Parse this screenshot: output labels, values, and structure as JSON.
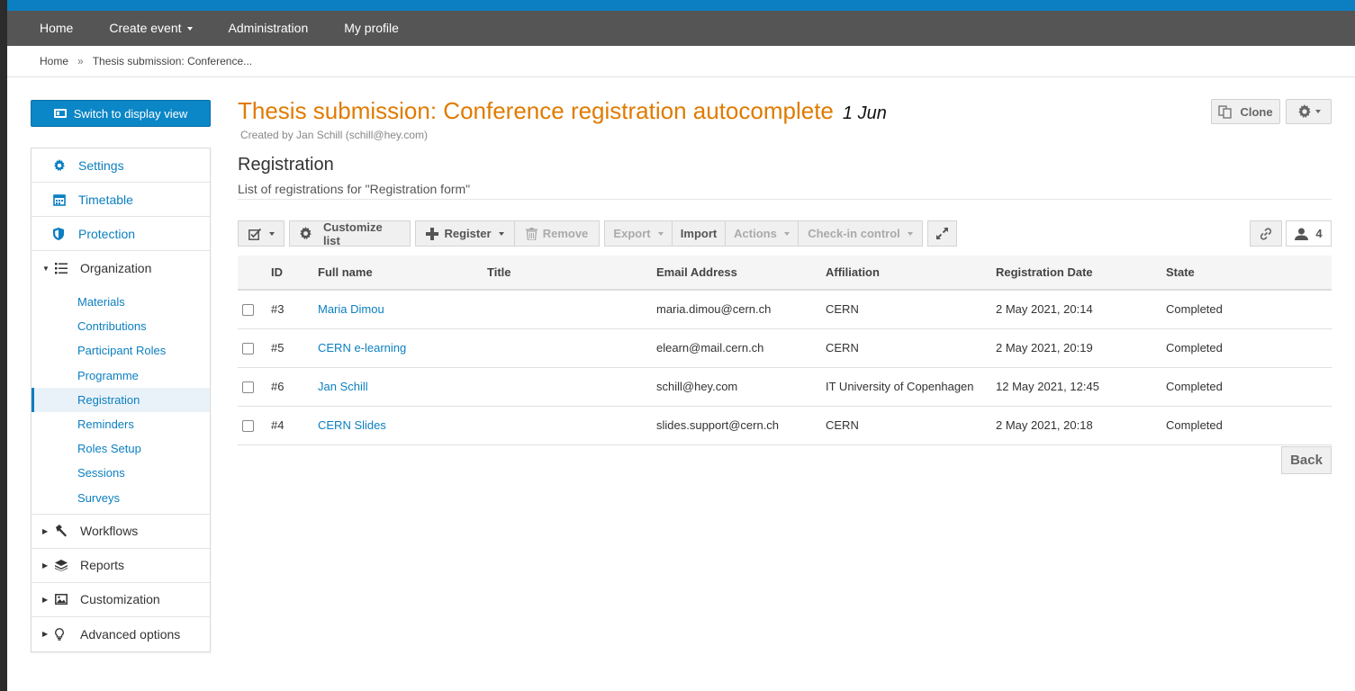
{
  "nav": {
    "home": "Home",
    "create_event": "Create event",
    "administration": "Administration",
    "my_profile": "My profile"
  },
  "breadcrumb": {
    "home": "Home",
    "separator": "»",
    "current": "Thesis submission: Conference..."
  },
  "sidebar": {
    "switch_button": "Switch to display view",
    "settings": "Settings",
    "timetable": "Timetable",
    "protection": "Protection",
    "organization": "Organization",
    "organization_items": [
      "Materials",
      "Contributions",
      "Participant Roles",
      "Programme",
      "Registration",
      "Reminders",
      "Roles Setup",
      "Sessions",
      "Surveys"
    ],
    "workflows": "Workflows",
    "reports": "Reports",
    "customization": "Customization",
    "advanced_options": "Advanced options"
  },
  "header": {
    "title": "Thesis submission: Conference registration autocomplete",
    "date": "1 Jun",
    "created_by": "Created by Jan Schill (schill@hey.com)",
    "clone": "Clone"
  },
  "section": {
    "title": "Registration",
    "subtitle": "List of registrations for \"Registration form\""
  },
  "toolbar": {
    "customize": "Customize list",
    "register": "Register",
    "remove": "Remove",
    "export": "Export",
    "import": "Import",
    "actions": "Actions",
    "checkin": "Check-in control",
    "count": "4"
  },
  "table": {
    "headers": {
      "id": "ID",
      "full_name": "Full name",
      "title": "Title",
      "email": "Email Address",
      "affiliation": "Affiliation",
      "date": "Registration Date",
      "state": "State"
    },
    "rows": [
      {
        "id": "#3",
        "name": "Maria Dimou",
        "title": "",
        "email": "maria.dimou@cern.ch",
        "affiliation": "CERN",
        "date": "2 May 2021, 20:14",
        "state": "Completed"
      },
      {
        "id": "#5",
        "name": "CERN e-learning",
        "title": "",
        "email": "elearn@mail.cern.ch",
        "affiliation": "CERN",
        "date": "2 May 2021, 20:19",
        "state": "Completed"
      },
      {
        "id": "#6",
        "name": "Jan Schill",
        "title": "",
        "email": "schill@hey.com",
        "affiliation": "IT University of Copenhagen",
        "date": "12 May 2021, 12:45",
        "state": "Completed"
      },
      {
        "id": "#4",
        "name": "CERN Slides",
        "title": "",
        "email": "slides.support@cern.ch",
        "affiliation": "CERN",
        "date": "2 May 2021, 20:18",
        "state": "Completed"
      }
    ]
  },
  "back": "Back",
  "colors": {
    "accent": "#0b7fc1",
    "title": "#e07b00",
    "nav_bg": "#555555"
  }
}
